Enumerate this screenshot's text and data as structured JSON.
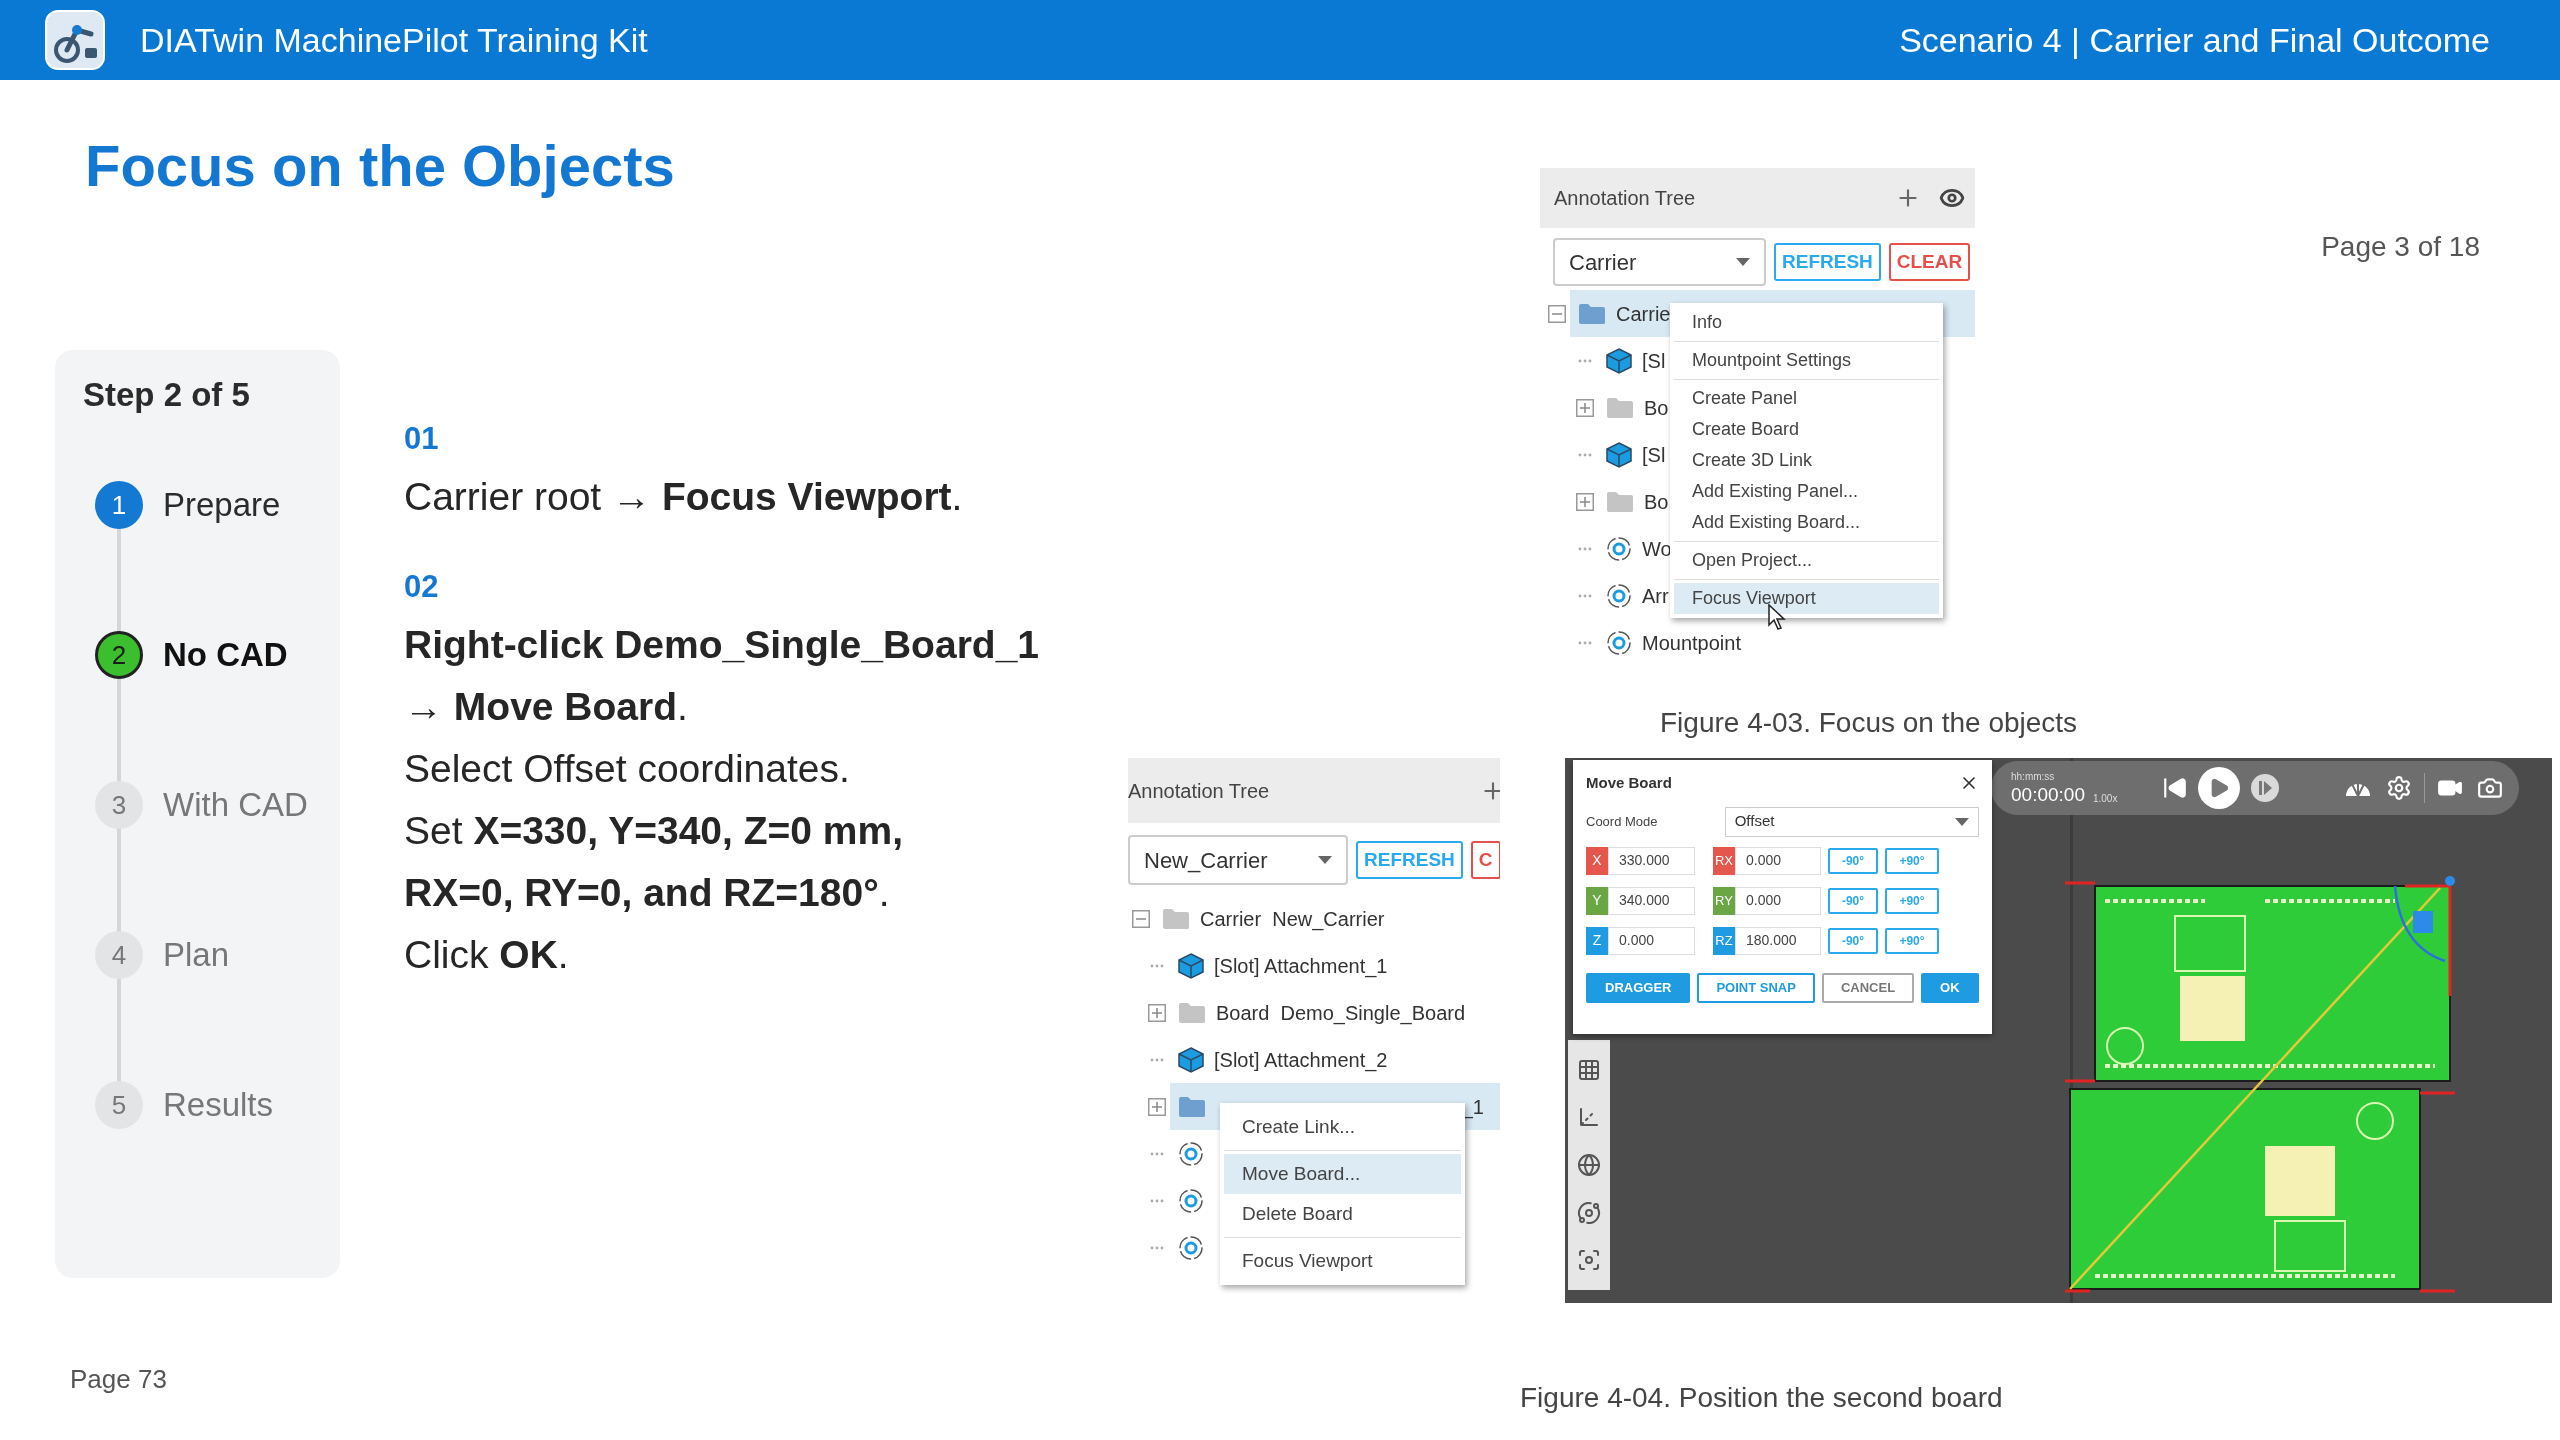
{
  "header": {
    "title": "DIATwin MachinePilot Training Kit",
    "scenario": "Scenario 4 | Carrier and Final Outcome"
  },
  "page_title": "Focus on the Objects",
  "page_counter": "Page 3 of 18",
  "steps_panel": {
    "heading": "Step 2 of 5",
    "steps": [
      {
        "number": "1",
        "label": "Prepare",
        "done": true,
        "current": false
      },
      {
        "number": "2",
        "label": "No CAD",
        "done": false,
        "current": true
      },
      {
        "number": "3",
        "label": "With CAD",
        "done": false,
        "current": false
      },
      {
        "number": "4",
        "label": "Plan",
        "done": false,
        "current": false
      },
      {
        "number": "5",
        "label": "Results",
        "done": false,
        "current": false
      }
    ]
  },
  "instructions": [
    {
      "number": "01",
      "lines": [
        "Carrier root → **Focus Viewport**."
      ]
    },
    {
      "number": "02",
      "lines": [
        "**Right-click Demo_Single_Board_1**",
        "→ **Move Board**.",
        "Select Offset coordinates.",
        "Set **X=330, Y=340, Z=0 mm,**",
        "**RX=0, RY=0, and RZ=180°**.",
        "Click **OK**."
      ]
    }
  ],
  "figure_1": {
    "panel_title": "Annotation Tree",
    "dropdown_value": "Carrier",
    "buttons": [
      {
        "label": "REFRESH",
        "kind": "refresh"
      },
      {
        "label": "CLEAR",
        "kind": "clear"
      }
    ],
    "tree": [
      {
        "label": "Carrie",
        "kind": "folder",
        "expanded": true,
        "selected": true,
        "children": [
          {
            "label": "[Sl",
            "kind": "slot",
            "selected": false
          },
          {
            "label": "Bo",
            "kind": "folder",
            "expanded": false,
            "selected": false
          },
          {
            "label": "[Sl",
            "kind": "slot",
            "selected": false
          },
          {
            "label": "Bo",
            "kind": "folder",
            "expanded": false,
            "selected": false
          },
          {
            "label": "Wo",
            "kind": "mountpoint",
            "selected": false
          },
          {
            "label": "Arr",
            "kind": "mountpoint",
            "selected": false
          },
          {
            "label": "Mountpoint",
            "kind": "mountpoint",
            "selected": false
          }
        ]
      }
    ],
    "context_menu": {
      "groups": [
        {
          "items": [
            {
              "label": "Info",
              "selected": false
            }
          ]
        },
        {
          "items": [
            {
              "label": "Mountpoint Settings",
              "selected": false
            }
          ]
        },
        {
          "items": [
            {
              "label": "Create Panel",
              "selected": false
            },
            {
              "label": "Create Board",
              "selected": false
            },
            {
              "label": "Create 3D Link",
              "selected": false
            },
            {
              "label": "Add Existing Panel...",
              "selected": false
            },
            {
              "label": "Add Existing Board...",
              "selected": false
            }
          ]
        },
        {
          "items": [
            {
              "label": "Open Project...",
              "selected": false
            }
          ]
        },
        {
          "items": [
            {
              "label": "Focus Viewport",
              "selected": true
            }
          ]
        }
      ]
    },
    "caption": "Figure 4-03. Focus on the objects"
  },
  "figure_2": {
    "panel_title": "Annotation Tree",
    "dropdown_value": "New_Carrier",
    "buttons": [
      {
        "label": "REFRESH",
        "kind": "refresh"
      },
      {
        "label": "C",
        "kind": "clear"
      }
    ],
    "tree": [
      {
        "label": "Carrier  New_Carrier",
        "kind": "folder",
        "expanded": true,
        "selected": false,
        "children": [
          {
            "label": "[Slot] Attachment_1",
            "kind": "slot",
            "selected": false
          },
          {
            "label": "Board  Demo_Single_Board",
            "kind": "folder",
            "expanded": false,
            "selected": false
          },
          {
            "label": "[Slot] Attachment_2",
            "kind": "slot",
            "selected": false
          },
          {
            "tail": "_1",
            "kind": "folder",
            "expanded": false,
            "selected": true
          },
          {
            "kind": "mountpoint",
            "selected": false
          },
          {
            "kind": "mountpoint",
            "selected": false
          },
          {
            "kind": "mountpoint",
            "selected": false
          }
        ]
      }
    ],
    "context_menu": {
      "groups": [
        {
          "items": [
            {
              "label": "Create Link...",
              "selected": false
            }
          ]
        },
        {
          "items": [
            {
              "label": "Move Board...",
              "selected": true
            },
            {
              "label": "Delete Board",
              "selected": false
            }
          ]
        },
        {
          "items": [
            {
              "label": "Focus Viewport",
              "selected": false
            }
          ]
        }
      ]
    },
    "move_dialog": {
      "title": "Move Board",
      "coord_mode_label": "Coord Mode",
      "coord_mode_value": "Offset",
      "rows": [
        {
          "axis": "X",
          "value": "330.000",
          "color": "#e5574c",
          "rot_axis": "RX",
          "rot_value": "0.000",
          "minus": "-90°",
          "plus": "+90°"
        },
        {
          "axis": "Y",
          "value": "340.000",
          "color": "#6aa643",
          "rot_axis": "RY",
          "rot_value": "0.000",
          "minus": "-90°",
          "plus": "+90°"
        },
        {
          "axis": "Z",
          "value": "0.000",
          "color": "#1f9be2",
          "rot_axis": "RZ",
          "rot_value": "180.000",
          "minus": "-90°",
          "plus": "+90°"
        }
      ],
      "buttons": [
        {
          "label": "DRAGGER",
          "kind": "primary"
        },
        {
          "label": "POINT SNAP",
          "kind": "outline"
        },
        {
          "label": "CANCEL",
          "kind": "neutral"
        },
        {
          "label": "OK",
          "kind": "primary"
        }
      ]
    },
    "playback": {
      "time_label": "hh:mm:ss",
      "time": "00:00:00",
      "speed": "1.00x"
    },
    "caption": "Figure 4-04. Position the second board"
  },
  "footer": {
    "page": "Page 73"
  }
}
